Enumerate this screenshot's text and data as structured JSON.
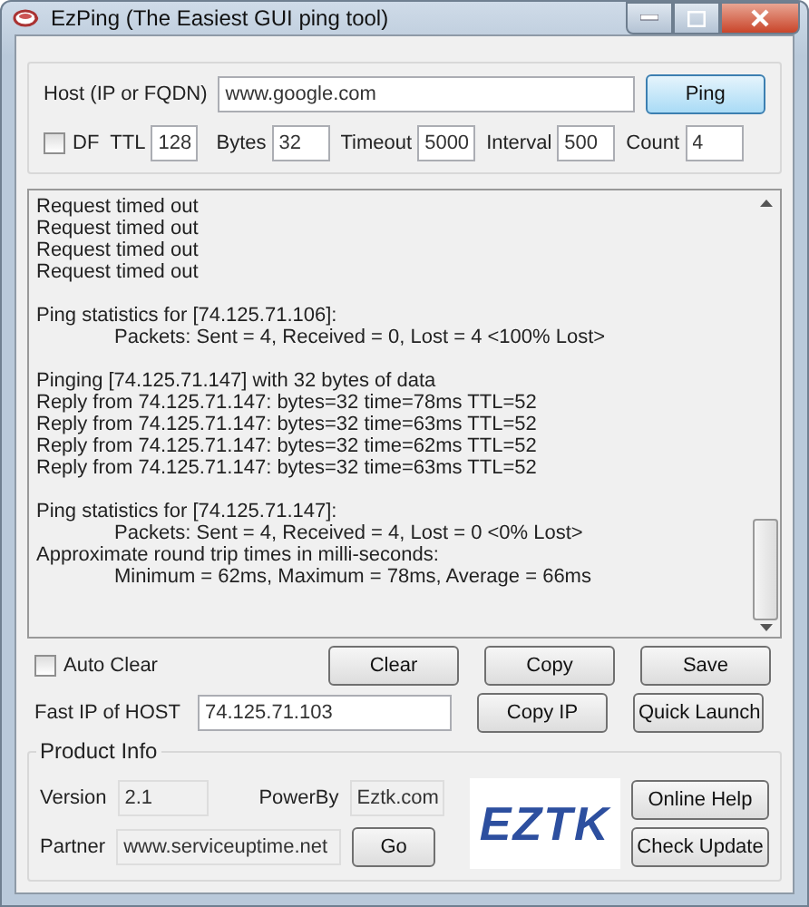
{
  "window": {
    "title": "EzPing (The Easiest GUI ping tool)"
  },
  "host": {
    "label": "Host (IP or FQDN)",
    "value": "www.google.com",
    "button": "Ping"
  },
  "options": {
    "df": {
      "label": "DF",
      "checked": false
    },
    "fields": [
      {
        "label": "TTL",
        "value": "128"
      },
      {
        "label": "Bytes",
        "value": "32"
      },
      {
        "label": "Timeout",
        "value": "5000"
      },
      {
        "label": "Interval",
        "value": "500"
      },
      {
        "label": "Count",
        "value": "4"
      }
    ]
  },
  "log": [
    [
      {
        "text": "Request timed out",
        "indent": false
      },
      {
        "text": "Request timed out",
        "indent": false
      },
      {
        "text": "Request timed out",
        "indent": false
      },
      {
        "text": "Request timed out",
        "indent": false
      }
    ],
    [
      {
        "text": "Ping statistics for [74.125.71.106]:",
        "indent": false
      },
      {
        "text": "Packets: Sent = 4, Received = 0, Lost = 4 <100% Lost>",
        "indent": true
      }
    ],
    [
      {
        "text": "Pinging [74.125.71.147] with 32 bytes of data",
        "indent": false
      },
      {
        "text": "Reply from 74.125.71.147: bytes=32 time=78ms TTL=52",
        "indent": false
      },
      {
        "text": "Reply from 74.125.71.147: bytes=32 time=63ms TTL=52",
        "indent": false
      },
      {
        "text": "Reply from 74.125.71.147: bytes=32 time=62ms TTL=52",
        "indent": false
      },
      {
        "text": "Reply from 74.125.71.147: bytes=32 time=63ms TTL=52",
        "indent": false
      }
    ],
    [
      {
        "text": "Ping statistics for [74.125.71.147]:",
        "indent": false
      },
      {
        "text": "Packets: Sent = 4, Received = 4, Lost = 0 <0% Lost>",
        "indent": true
      },
      {
        "text": "Approximate round trip times in milli-seconds:",
        "indent": false
      },
      {
        "text": "Minimum = 62ms, Maximum = 78ms, Average = 66ms",
        "indent": true
      }
    ]
  ],
  "auto_clear": {
    "label": "Auto Clear",
    "checked": false
  },
  "actions": [
    "Clear",
    "Copy",
    "Save"
  ],
  "fast_ip": {
    "label": "Fast IP of HOST",
    "value": "74.125.71.103",
    "buttons": [
      "Copy IP",
      "Quick Launch"
    ]
  },
  "product_info": {
    "title": "Product Info",
    "version_label": "Version",
    "version": "2.1",
    "powerby_label": "PowerBy",
    "powerby": "Eztk.com",
    "partner_label": "Partner",
    "partner": "www.serviceuptime.net",
    "go": "Go",
    "logo": "EZTK",
    "buttons": [
      "Online Help",
      "Check Update"
    ]
  }
}
